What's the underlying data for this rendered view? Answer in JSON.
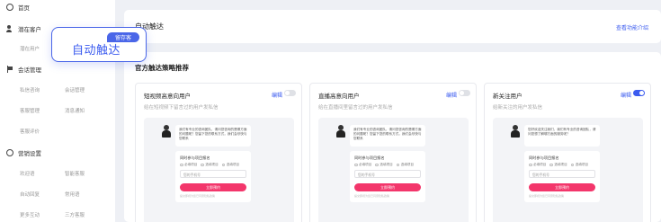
{
  "sidebar": {
    "items": [
      {
        "label": "首页",
        "icon": "home-icon"
      },
      {
        "label": "潜在客户",
        "icon": "users-icon"
      },
      {
        "label": "会话管理",
        "icon": "flag-icon"
      },
      {
        "label": "营销设置",
        "icon": "circle-icon"
      }
    ],
    "sub_items": [
      "潜在用户",
      "私信咨询",
      "会话管理",
      "客服管理",
      "消息通知",
      "客服评价",
      "欢迎语",
      "智能客服",
      "自动回复",
      "常用语",
      "更多互动",
      "三方客服"
    ]
  },
  "popup": {
    "label": "自动触达",
    "badge": "留存客"
  },
  "header": {
    "title": "自动触达",
    "link": "查看功能介绍"
  },
  "section_title": "官方触达策略推荐",
  "panels": [
    {
      "title": "短视频高意向用户",
      "edit": "编辑",
      "enabled": false,
      "desc": "给在短视频下留言过的用户发私信",
      "bubble": "我们有专业的咨询团队，请问您咨询的是哪方面的问题呢？您留下您的联系方式，我们会尽快与您联系",
      "form_title": "同时参与项目报名",
      "options": [
        "必填项目",
        "选填项目",
        "选填项目"
      ],
      "input_placeholder": "您的手机号",
      "button": "立即预约",
      "note": "提交即视为您已同意隐私政策"
    },
    {
      "title": "直播高意向用户",
      "edit": "编辑",
      "enabled": false,
      "desc": "给在直播间里留言过的用户发私信",
      "bubble": "我们有专业的咨询团队，请问您咨询的是哪方面的问题呢？您留下您的联系方式，我们会尽快与您联系",
      "form_title": "同时参与项目报名",
      "options": [
        "必填项目",
        "选填项目",
        "选填项目"
      ],
      "input_placeholder": "您的手机号",
      "button": "立即预约",
      "note": "提交即视为您已同意隐私政策"
    },
    {
      "title": "新关注用户",
      "edit": "编辑",
      "enabled": true,
      "desc": "给新关注的用户发私信",
      "bubble": "您好欢迎关注我们，我们有专业的咨询团队，请问您想了解哪方面的服务呢？",
      "form_title": "同时参与项目报名",
      "options": [
        "必填项目",
        "选填项目",
        "选填项目"
      ],
      "input_placeholder": "您的手机号",
      "button": "立即预约",
      "note": "提交即视为您已同意隐私政策"
    }
  ],
  "colors": {
    "accent": "#3b5bef",
    "button": "#f3366b"
  }
}
